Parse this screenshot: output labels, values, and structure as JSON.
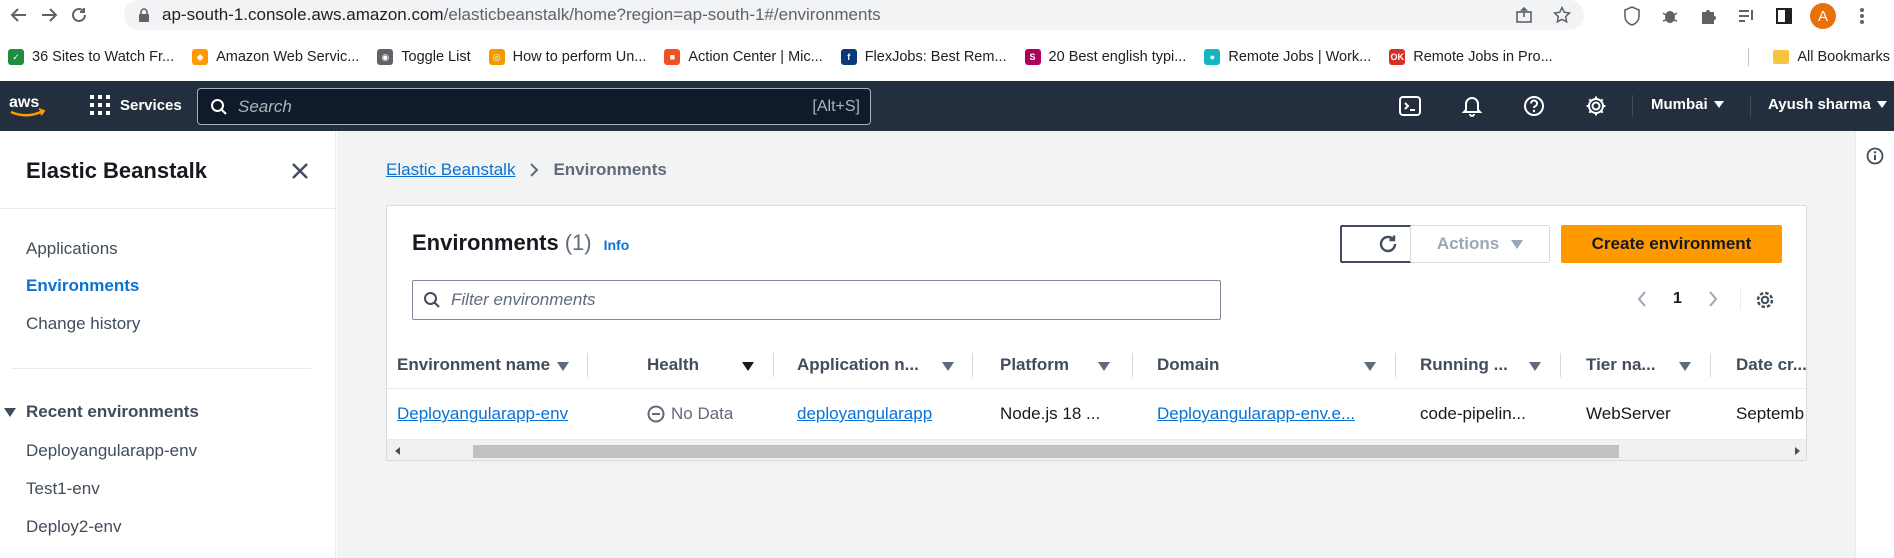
{
  "browser": {
    "url_host": "ap-south-1.console.aws.amazon.com",
    "url_path": "/elasticbeanstalk/home?region=ap-south-1#/environments",
    "avatar_letter": "A",
    "bookmarks": [
      {
        "label": "36 Sites to Watch Fr...",
        "icon": "checkmark-favicon",
        "color": "#1e8e3e"
      },
      {
        "label": "Amazon Web Servic...",
        "icon": "aws-cube-favicon",
        "color": "#ff9900"
      },
      {
        "label": "Toggle List",
        "icon": "globe-favicon",
        "color": "#5f6368"
      },
      {
        "label": "How to perform Un...",
        "icon": "eye-favicon",
        "color": "#f29900"
      },
      {
        "label": "Action Center | Mic...",
        "icon": "microsoft-favicon",
        "color": "#f25022"
      },
      {
        "label": "FlexJobs: Best Rem...",
        "icon": "flexjobs-favicon",
        "color": "#0b3a7a"
      },
      {
        "label": "20 Best english typi...",
        "icon": "s-favicon",
        "color": "#b0005a"
      },
      {
        "label": "Remote Jobs | Work...",
        "icon": "remote-favicon",
        "color": "#13b5c1"
      },
      {
        "label": "Remote Jobs in Pro...",
        "icon": "ok-favicon",
        "color": "#d93025"
      }
    ],
    "all_bookmarks": "All Bookmarks"
  },
  "aws_nav": {
    "services_label": "Services",
    "search_placeholder": "Search",
    "search_shortcut": "[Alt+S]",
    "region": "Mumbai",
    "user": "Ayush sharma"
  },
  "sidebar": {
    "title": "Elastic Beanstalk",
    "items": [
      {
        "label": "Applications",
        "active": false
      },
      {
        "label": "Environments",
        "active": true
      },
      {
        "label": "Change history",
        "active": false
      }
    ],
    "recent_heading": "Recent environments",
    "recent": [
      "Deployangularapp-env",
      "Test1-env",
      "Deploy2-env"
    ]
  },
  "breadcrumb": {
    "root": "Elastic Beanstalk",
    "current": "Environments"
  },
  "panel": {
    "title": "Environments",
    "count": "(1)",
    "info": "Info",
    "actions_label": "Actions",
    "create_label": "Create environment",
    "filter_placeholder": "Filter environments",
    "page": "1",
    "columns": [
      "Environment name",
      "Health",
      "Application n...",
      "Platform",
      "Domain",
      "Running ...",
      "Tier na...",
      "Date cr..."
    ],
    "rows": [
      {
        "env_name": "Deployangularapp-env",
        "health": "No Data",
        "application": "deployangularapp",
        "platform": "Node.js 18 ...",
        "domain": "Deployangularapp-env.e...",
        "running": "code-pipelin...",
        "tier": "WebServer",
        "date": "Septemb"
      }
    ]
  },
  "colors": {
    "aws_nav_bg": "#232f3e",
    "primary_orange": "#ff9900",
    "link_blue": "#0972d3"
  }
}
